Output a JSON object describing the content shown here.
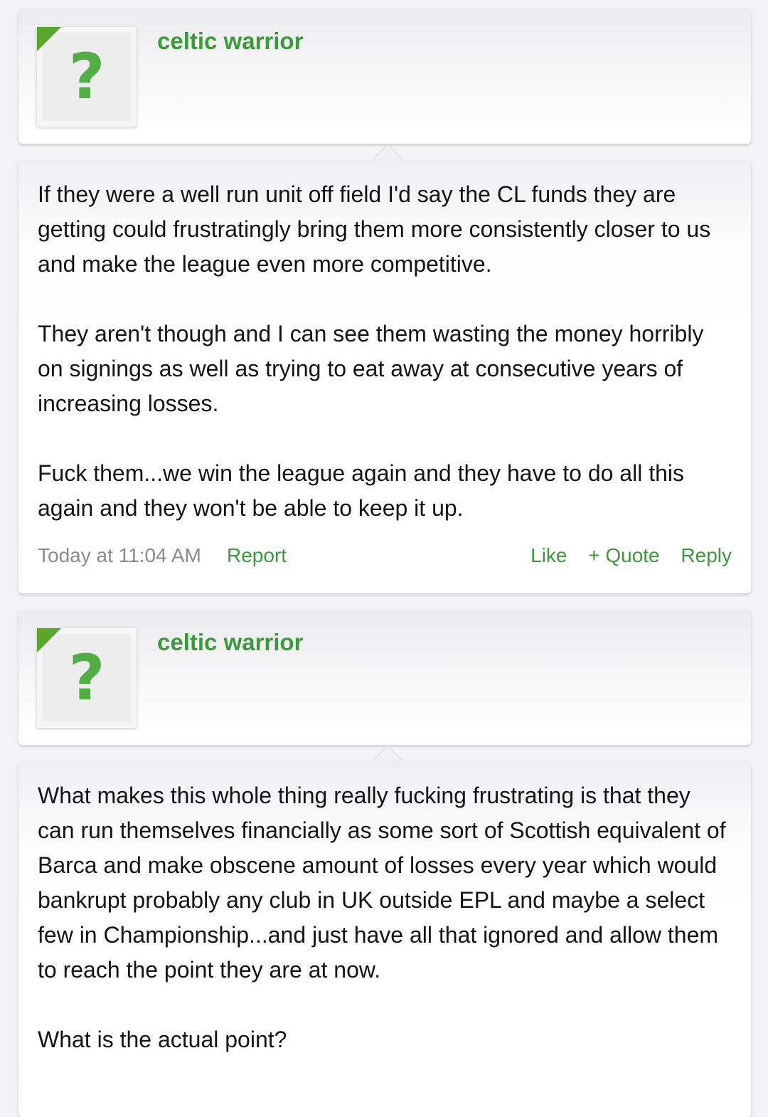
{
  "posts": [
    {
      "username": "celtic warrior",
      "avatar_glyph": "?",
      "paragraphs": [
        "If they were a well run unit off field I'd say the CL funds they are getting could frustratingly bring them more consistently closer to us and make the league even more competitive.",
        "They aren't though and I can see them wasting the money horribly on signings as well as trying to eat away at consecutive years of increasing losses.",
        "Fuck them...we win the league again and they have to do all this again and they won't be able to keep it up."
      ],
      "timestamp": "Today at 11:04 AM",
      "report_label": "Report",
      "like_label": "Like",
      "quote_label": "+ Quote",
      "reply_label": "Reply"
    },
    {
      "username": "celtic warrior",
      "avatar_glyph": "?",
      "paragraphs": [
        "What makes this whole thing really fucking frustrating is that they can run themselves financially as some sort of Scottish equivalent of Barca and make obscene amount of losses every year which would bankrupt probably any club in UK outside EPL and maybe a select few in Championship...and just have all that ignored and allow them to reach the point they are at now.",
        "What is the actual point?"
      ]
    }
  ],
  "colors": {
    "accent_green": "#3c9a3c",
    "avatar_question_green": "#52ad47",
    "avatar_corner_green": "#5aa62e",
    "timestamp_gray": "#8b8b8b"
  }
}
